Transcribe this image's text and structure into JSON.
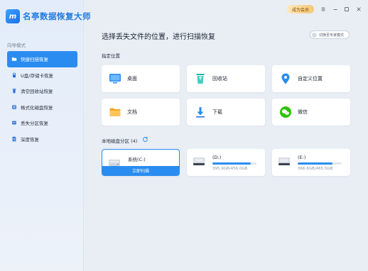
{
  "app": {
    "logo_mark": "m",
    "title": "名亭数据恢复大师"
  },
  "titlebar": {
    "upgrade_label": "成为会员"
  },
  "sidebar": {
    "section_label": "向导模式",
    "items": [
      {
        "label": "快捷扫描恢复",
        "icon": "folder-icon",
        "active": true
      },
      {
        "label": "U盘/存储卡恢复",
        "icon": "usb-drive-icon",
        "active": false
      },
      {
        "label": "清空回收站恢复",
        "icon": "trash-icon",
        "active": false
      },
      {
        "label": "格式化磁盘恢复",
        "icon": "format-disk-icon",
        "active": false
      },
      {
        "label": "丢失分区恢复",
        "icon": "lost-partition-icon",
        "active": false
      },
      {
        "label": "深度恢复",
        "icon": "deep-recovery-icon",
        "active": false
      }
    ]
  },
  "main": {
    "heading": "选择丢失文件的位置，进行扫描恢复",
    "expert_mode_label": "切换至专家模式",
    "locations_title": "指定位置",
    "locations": [
      {
        "label": "桌面",
        "icon": "desktop-icon"
      },
      {
        "label": "回收站",
        "icon": "recycle-bin-icon"
      },
      {
        "label": "自定义位置",
        "icon": "location-pin-icon"
      },
      {
        "label": "文档",
        "icon": "documents-folder-icon"
      },
      {
        "label": "下载",
        "icon": "download-icon"
      },
      {
        "label": "微信",
        "icon": "wechat-icon"
      }
    ],
    "disks_title": "本地磁盘分区 (4)",
    "disks": [
      {
        "name": "系统(C:)",
        "action": "立即扫描",
        "selected": true
      },
      {
        "name": "(D:)",
        "size": "395.9GB/456.0GB",
        "used_fraction": 0.87
      },
      {
        "name": "(E:)",
        "size": "366.6GB/465.5GB",
        "used_fraction": 0.79
      }
    ]
  },
  "colors": {
    "accent": "#2a8cf0",
    "brand": "#1f7ae0",
    "upgrade_gold": "#f6c775"
  }
}
